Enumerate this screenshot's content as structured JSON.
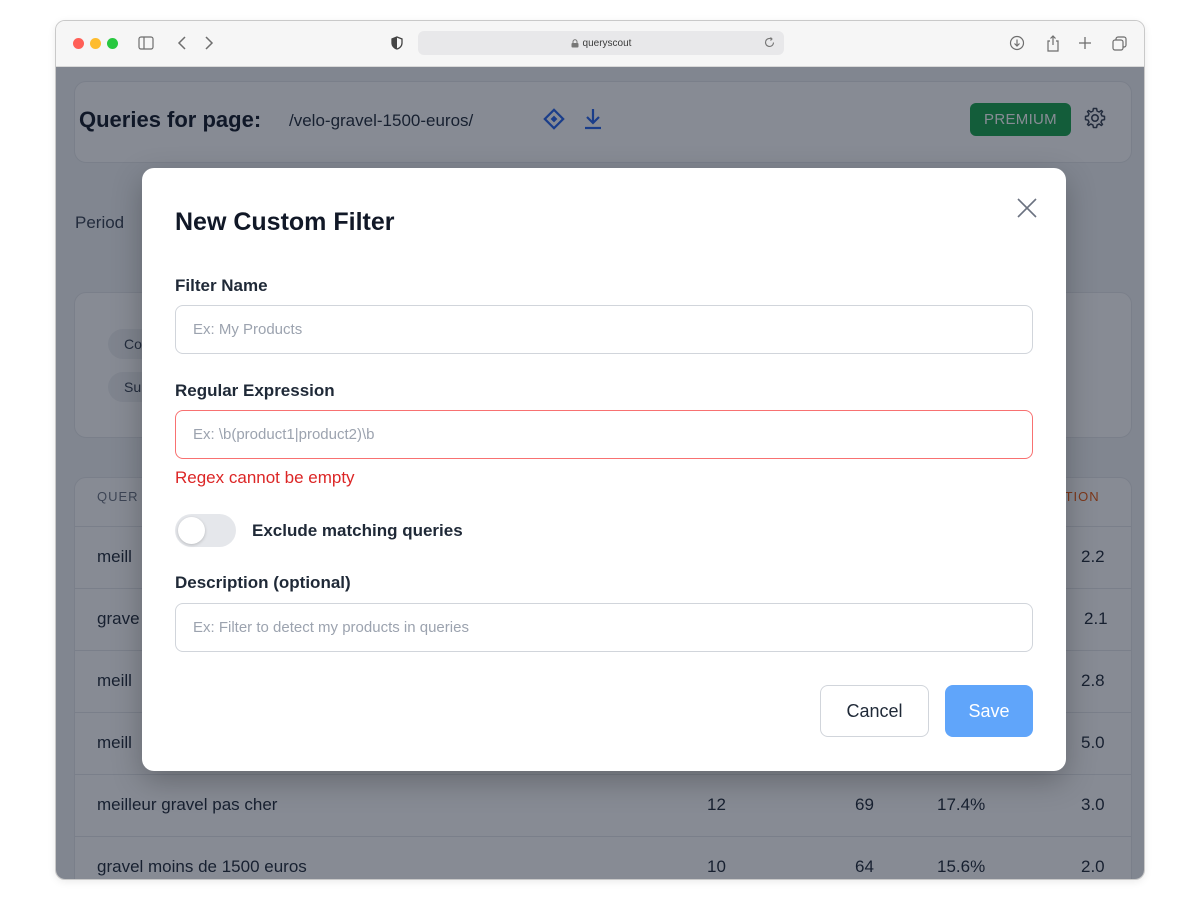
{
  "browser": {
    "url": "queryscout"
  },
  "header": {
    "title": "Queries for page:",
    "path": "/velo-gravel-1500-euros/",
    "badge": "PREMIUM"
  },
  "period": {
    "label": "Period"
  },
  "filters": {
    "chips": [
      "Co",
      "Su"
    ]
  },
  "table": {
    "headers": {
      "query": "QUER",
      "position": "ITION"
    },
    "rows": [
      {
        "query": "meill",
        "clicks": "",
        "impressions": "",
        "ctr": "",
        "position": "2.2"
      },
      {
        "query": "grave",
        "clicks": "",
        "impressions": "",
        "ctr": "",
        "position": "2.1"
      },
      {
        "query": "meill",
        "clicks": "",
        "impressions": "",
        "ctr": "",
        "position": "2.8"
      },
      {
        "query": "meill",
        "clicks": "",
        "impressions": "",
        "ctr": "",
        "position": "5.0"
      },
      {
        "query": "meilleur gravel pas cher",
        "clicks": "12",
        "impressions": "69",
        "ctr": "17.4%",
        "position": "3.0"
      },
      {
        "query": "gravel moins de 1500 euros",
        "clicks": "10",
        "impressions": "64",
        "ctr": "15.6%",
        "position": "2.0"
      }
    ]
  },
  "modal": {
    "title": "New Custom Filter",
    "filter_name": {
      "label": "Filter Name",
      "placeholder": "Ex: My Products",
      "value": ""
    },
    "regex": {
      "label": "Regular Expression",
      "placeholder": "Ex: \\b(product1|product2)\\b",
      "value": "",
      "error": "Regex cannot be empty"
    },
    "exclude": {
      "label": "Exclude matching queries",
      "checked": false
    },
    "description": {
      "label": "Description (optional)",
      "placeholder": "Ex: Filter to detect my products in queries",
      "value": ""
    },
    "cancel_label": "Cancel",
    "save_label": "Save"
  },
  "colors": {
    "accent": "#2563eb",
    "premium": "#16a34a",
    "error": "#dc2626",
    "save": "#60a5fa"
  },
  "icons": [
    "sidebar-icon",
    "back-icon",
    "forward-icon",
    "shield-icon",
    "lock-icon",
    "reload-icon",
    "download-icon",
    "share-icon",
    "plus-icon",
    "tabs-icon",
    "diamond-icon",
    "gear-icon",
    "close-icon"
  ]
}
